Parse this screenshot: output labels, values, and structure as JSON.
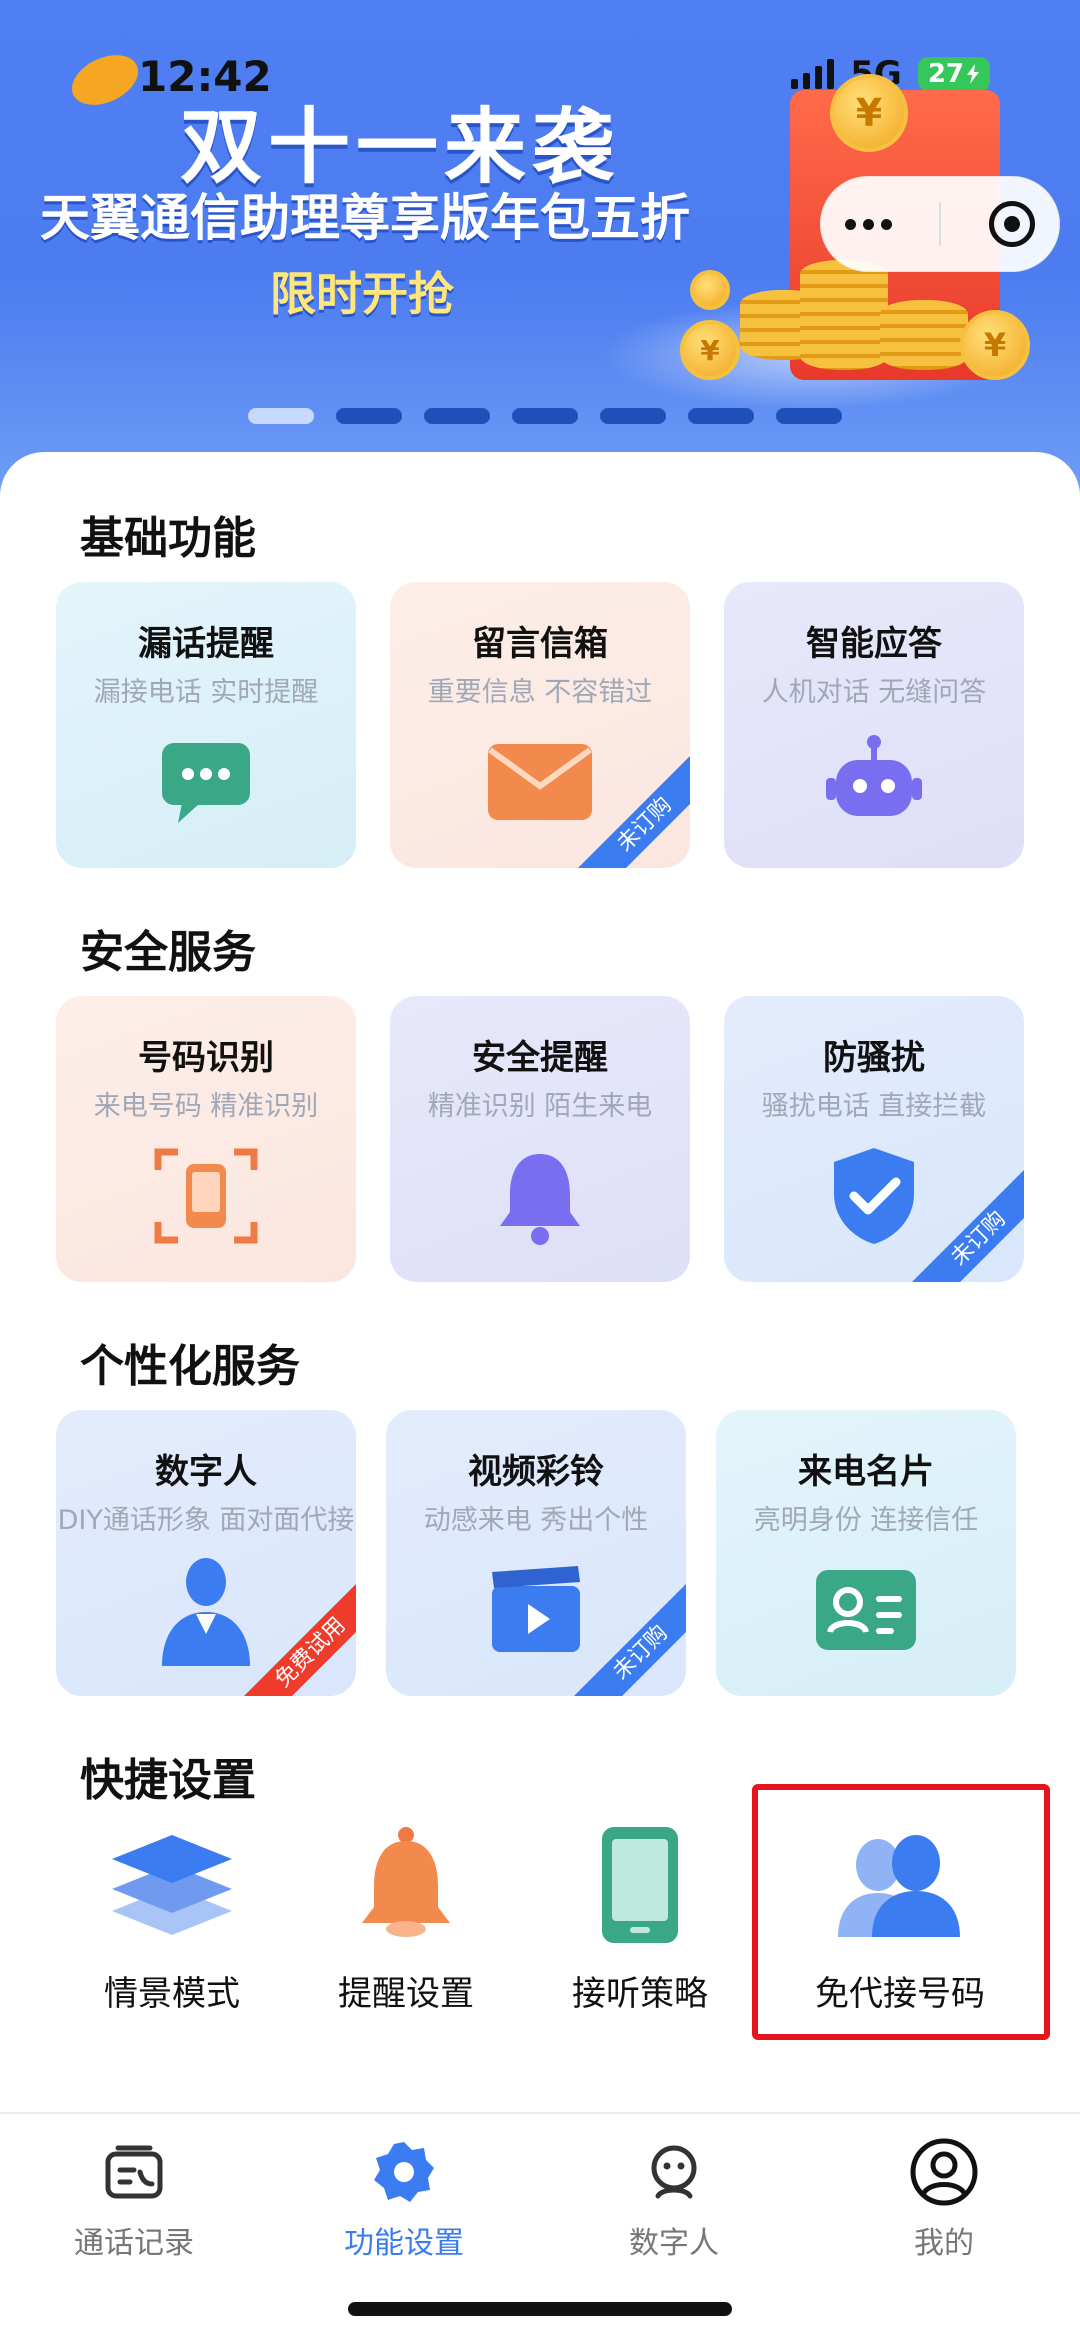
{
  "status_bar": {
    "time": "12:42",
    "network": "5G",
    "battery": "27"
  },
  "banner": {
    "title": "双十一来袭",
    "subtitle": "天翼通信助理尊享版年包五折",
    "cta": "限时开抢",
    "coin_symbol": "¥",
    "slides_total": 7,
    "active_slide": 1
  },
  "sections": {
    "basic": {
      "title": "基础功能",
      "cards": [
        {
          "title": "漏话提醒",
          "subtitle": "漏接电话 实时提醒",
          "icon": "chat-bubble-icon"
        },
        {
          "title": "留言信箱",
          "subtitle": "重要信息 不容错过",
          "icon": "envelope-icon",
          "badge": "未订购"
        },
        {
          "title": "智能应答",
          "subtitle": "人机对话 无缝问答",
          "icon": "robot-icon"
        }
      ]
    },
    "security": {
      "title": "安全服务",
      "cards": [
        {
          "title": "号码识别",
          "subtitle": "来电号码 精准识别",
          "icon": "phone-scan-icon"
        },
        {
          "title": "安全提醒",
          "subtitle": "精准识别 陌生来电",
          "icon": "bell-icon"
        },
        {
          "title": "防骚扰",
          "subtitle": "骚扰电话 直接拦截",
          "icon": "shield-check-icon",
          "badge": "未订购"
        }
      ]
    },
    "personal": {
      "title": "个性化服务",
      "cards": [
        {
          "title": "数字人",
          "subtitle": "DIY通话形象 面对面代接",
          "icon": "digital-person-icon",
          "badge": "免费试用"
        },
        {
          "title": "视频彩铃",
          "subtitle": "动感来电 秀出个性",
          "icon": "video-play-icon",
          "badge": "未订购"
        },
        {
          "title": "来电名片",
          "subtitle": "亮明身份 连接信任",
          "icon": "contact-card-icon"
        }
      ]
    },
    "quick": {
      "title": "快捷设置",
      "items": [
        {
          "label": "情景模式",
          "icon": "layers-icon"
        },
        {
          "label": "提醒设置",
          "icon": "bell-icon"
        },
        {
          "label": "接听策略",
          "icon": "phone-icon"
        },
        {
          "label": "免代接号码",
          "icon": "users-icon"
        }
      ]
    }
  },
  "tabbar": {
    "items": [
      {
        "label": "通话记录",
        "icon": "call-log-icon"
      },
      {
        "label": "功能设置",
        "icon": "gear-icon",
        "active": true
      },
      {
        "label": "数字人",
        "icon": "digital-person-icon"
      },
      {
        "label": "我的",
        "icon": "profile-icon"
      }
    ]
  },
  "colors": {
    "accent": "#3b7cf0",
    "highlight_border": "#e8141c",
    "badge_red": "#ef3b2c"
  }
}
